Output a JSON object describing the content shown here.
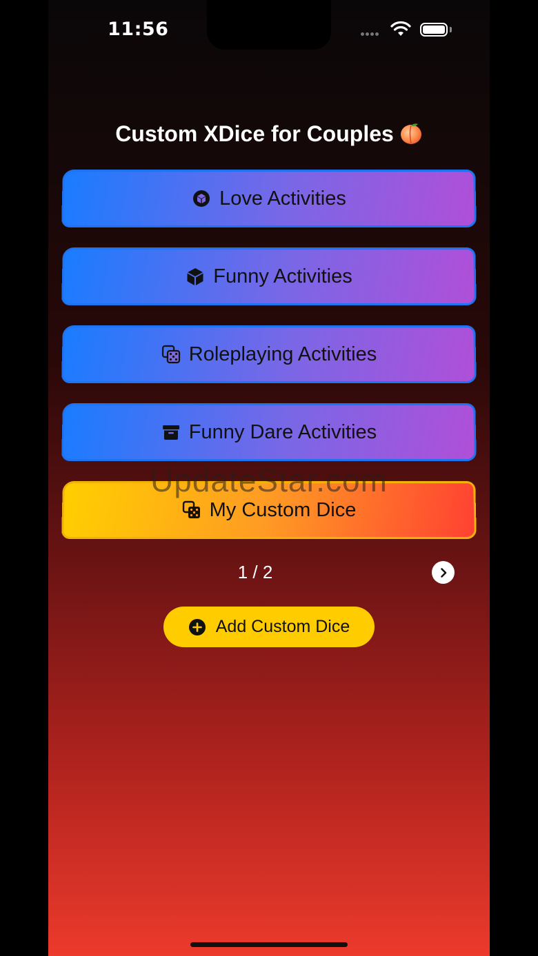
{
  "status_bar": {
    "time": "11:56"
  },
  "title": "Custom XDice for Couples",
  "dice_buttons": [
    {
      "label": "Love Activities",
      "icon": "cube-circle-icon"
    },
    {
      "label": "Funny Activities",
      "icon": "cube-icon"
    },
    {
      "label": "Roleplaying Activities",
      "icon": "dice-icon"
    },
    {
      "label": "Funny Dare Activities",
      "icon": "archive-box-icon"
    },
    {
      "label": "My Custom Dice",
      "icon": "dice-stack-icon"
    }
  ],
  "watermark": "UpdateStar.com",
  "pager": {
    "text": "1 / 2"
  },
  "add_button": {
    "label": "Add Custom Dice",
    "icon": "plus-circle-icon"
  },
  "colors": {
    "blue_start": "#1a7cff",
    "purple_end": "#b04fd8",
    "yellow": "#ffcc00",
    "red": "#ff4132"
  }
}
